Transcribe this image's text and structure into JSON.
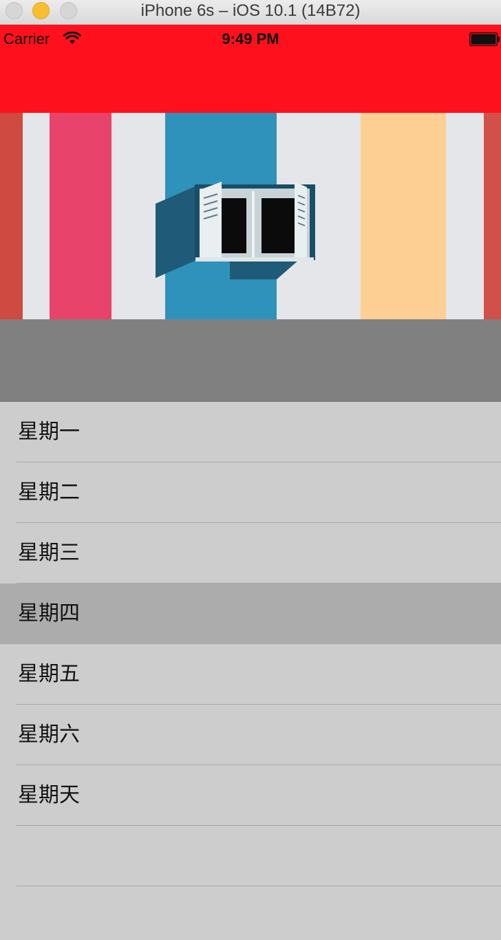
{
  "window": {
    "title": "iPhone 6s – iOS 10.1 (14B72)"
  },
  "status_bar": {
    "carrier": "Carrier",
    "time": "9:49 PM"
  },
  "colors": {
    "header": "#fe111c",
    "gray_section": "#808080",
    "table_bg": "#cdcdcd",
    "selected_row": "#acacac"
  },
  "table": {
    "rows": [
      {
        "label": "星期一"
      },
      {
        "label": "星期二"
      },
      {
        "label": "星期三"
      },
      {
        "label": "星期四",
        "selected": true
      },
      {
        "label": "星期五"
      },
      {
        "label": "星期六"
      },
      {
        "label": "星期天"
      },
      {
        "label": ""
      }
    ]
  }
}
